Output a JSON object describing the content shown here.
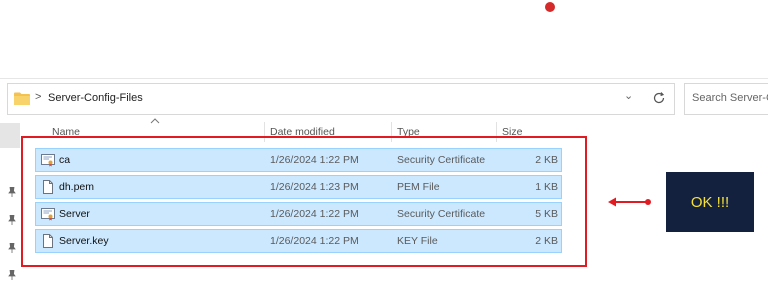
{
  "address_bar": {
    "breadcrumb_separator": ">",
    "current_folder": "Server-Config-Files"
  },
  "search": {
    "placeholder": "Search Server-Config-Files"
  },
  "columns": {
    "name": "Name",
    "date": "Date modified",
    "type": "Type",
    "size": "Size"
  },
  "files": [
    {
      "name": "ca",
      "date": "1/26/2024 1:22 PM",
      "type": "Security Certificate",
      "size": "2 KB",
      "icon": "certificate-icon"
    },
    {
      "name": "dh.pem",
      "date": "1/26/2024 1:23 PM",
      "type": "PEM File",
      "size": "1 KB",
      "icon": "blank-file-icon"
    },
    {
      "name": "Server",
      "date": "1/26/2024 1:22 PM",
      "type": "Security Certificate",
      "size": "5 KB",
      "icon": "certificate-icon"
    },
    {
      "name": "Server.key",
      "date": "1/26/2024 1:22 PM",
      "type": "KEY File",
      "size": "2 KB",
      "icon": "blank-file-icon"
    }
  ],
  "annotation": {
    "label": "OK !!!",
    "colors": {
      "outline": "#e11b22",
      "box_background": "#13213f",
      "box_text": "#f7e232"
    }
  },
  "colors": {
    "selection_fill": "#cce8ff",
    "selection_border": "#99d1ff",
    "folder": "#f3c24f"
  }
}
